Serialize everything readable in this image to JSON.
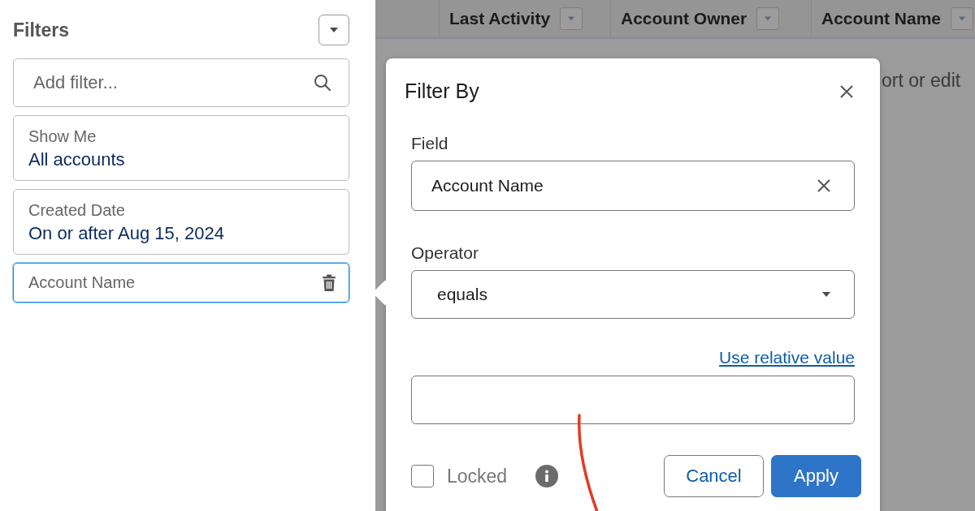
{
  "filters_panel": {
    "title": "Filters",
    "search": {
      "placeholder": "Add filter..."
    },
    "filters": [
      {
        "label": "Show Me",
        "value": "All accounts",
        "selected": false
      },
      {
        "label": "Created Date",
        "value": "On or after Aug 15, 2024",
        "selected": false
      },
      {
        "label": "Account Name",
        "selected": true
      }
    ]
  },
  "table": {
    "columns": [
      "Last Activity",
      "Account Owner",
      "Account Name"
    ],
    "message": "ort or edit"
  },
  "popover": {
    "title": "Filter By",
    "field": {
      "label": "Field",
      "value": "Account Name"
    },
    "operator": {
      "label": "Operator",
      "value": "equals"
    },
    "relative_link": "Use relative value",
    "locked": {
      "label": "Locked",
      "checked": false
    },
    "buttons": [
      {
        "label": "Cancel",
        "kind": "neutral"
      },
      {
        "label": "Apply",
        "kind": "brand"
      }
    ]
  }
}
